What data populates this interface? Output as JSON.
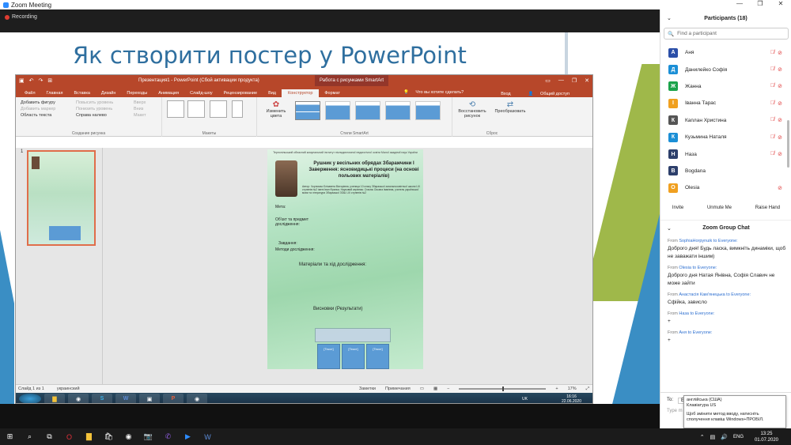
{
  "window": {
    "title": "Zoom Meeting"
  },
  "recording": {
    "label": "Recording"
  },
  "slide": {
    "title": "Як створити постер у PowerPoint"
  },
  "ppt": {
    "doc_title": "Презентация1 - PowerPoint (Сбой активации продукта)",
    "context_tab": "Работа с рисунками SmartArt",
    "tabs": [
      "Файл",
      "Главная",
      "Вставка",
      "Дизайн",
      "Переходы",
      "Анимация",
      "Слайд-шоу",
      "Рецензирование",
      "Вид",
      "Конструктор",
      "Формат"
    ],
    "active_tab": "Конструктор",
    "tell_me": "Что вы хотите сделать?",
    "sign_in": "Вход",
    "share": "Общий доступ",
    "group_create": {
      "label": "Создание рисунка",
      "btn_add": "Добавить фигуру",
      "btn_bullet": "Добавить маркер",
      "btn_textpane": "Область текста",
      "btn_promote": "Повысить уровень",
      "btn_demote": "Понизить уровень",
      "btn_rtl": "Справа налево",
      "btn_up": "Вверх",
      "btn_down": "Вниз",
      "btn_layout": "Макет"
    },
    "group_layouts": {
      "label": "Макеты"
    },
    "group_styles": {
      "label": "Стили SmartArt",
      "change_colors": "Изменить цвета"
    },
    "group_reset": {
      "label": "Сброс",
      "reset": "Восстановить рисунок",
      "convert": "Преобразовать"
    },
    "slide_number": "1",
    "status": {
      "slide": "Слайд 1 из 1",
      "lang": "украинский",
      "notes": "Заметки",
      "comments": "Примечания",
      "zoom": "17%"
    },
    "win7": {
      "lang": "UK",
      "time": "16:16",
      "date": "22.06.2020"
    },
    "poster": {
      "header": "Тернопільський обласний комунальний інститут післядипломної педагогічної освіти Малої академії наук України",
      "title": "Рушник у весільних обрядах Збаражчини І Заверження: ясновидицькі процеси (на основі польових матеріалів)",
      "info": "Автор: Чорномаз Єлізавета Вікторівна, учениця 10 класу Збаразької загальноосвітньої школи І-ІІІ ступенів №2 імені Іван Франка. Науковий керівник: Стасюк Оксана Іванівна, учитель української мови та літератури Збаразької ЗОШ І-ІІІ ступенів №2",
      "goal": "Мета:",
      "object": "Об'єкт та предмет дослідження:",
      "tasks": "Завдання:",
      "methods": "Методи дослідження:",
      "materials": "Матеріали та хід дослідження:",
      "conclusions": "Висновки (Результати)",
      "box_text": "[Текст]"
    }
  },
  "participants": {
    "header": "Participants (18)",
    "search_placeholder": "Find a participant",
    "items": [
      {
        "name": "Аня",
        "initial": "A",
        "color": "#2b4fa8",
        "muted": true
      },
      {
        "name": "Данилейко Софія",
        "initial": "Д",
        "color": "#1b8fd6",
        "muted": true
      },
      {
        "name": "Жанна",
        "initial": "Ж",
        "color": "#1aa34a",
        "muted": true
      },
      {
        "name": "Іванна Тарас",
        "initial": "І",
        "color": "#f0a020",
        "muted": true
      },
      {
        "name": "Каплан Христина",
        "initial": "К",
        "color": "#555555",
        "muted": true
      },
      {
        "name": "Кузьмина Наталя",
        "initial": "К",
        "color": "#1b8fd6",
        "muted": true
      },
      {
        "name": "Наза",
        "initial": "Н",
        "color": "#2d3f6b",
        "muted": true
      },
      {
        "name": "Bogdana",
        "initial": "B",
        "color": "#2d3f6b",
        "muted": false
      },
      {
        "name": "Olesia",
        "initial": "O",
        "color": "#f0a020",
        "muted": true
      }
    ],
    "buttons": {
      "invite": "Invite",
      "unmute": "Unmute Me",
      "raise": "Raise Hand"
    }
  },
  "chat": {
    "header": "Zoom Group Chat",
    "messages": [
      {
        "from": "From",
        "sender": "SophiaHorpynuik to Everyone:",
        "text": "Доброго дня! Будь ласка, вимкніть динаміки, щоб не заважати іншим)"
      },
      {
        "from": "From",
        "sender": "Olesia to Everyone:",
        "text": "Доброго дня Натая Янівна, Софія Славич не може зайти"
      },
      {
        "from": "From",
        "sender": "Анастасія Кам'янецька to Everyone:",
        "text": "Сфійка, зависло"
      },
      {
        "from": "From",
        "sender": "Наза to Everyone:",
        "text": "+"
      },
      {
        "from": "From",
        "sender": "Аня to Everyone:",
        "text": "+"
      }
    ],
    "to_label": "To:",
    "to_value": "Ev",
    "type_placeholder": "Type m"
  },
  "tooltip": {
    "line1": "англійська (США)",
    "line2": "Клавіатура US",
    "line3": "Щоб змінити метод вводу, натисніть сполучення клавіш Windows+ПРОБІЛ."
  },
  "win10": {
    "lang": "ENG",
    "time": "13:25",
    "date": "01.07.2020"
  }
}
